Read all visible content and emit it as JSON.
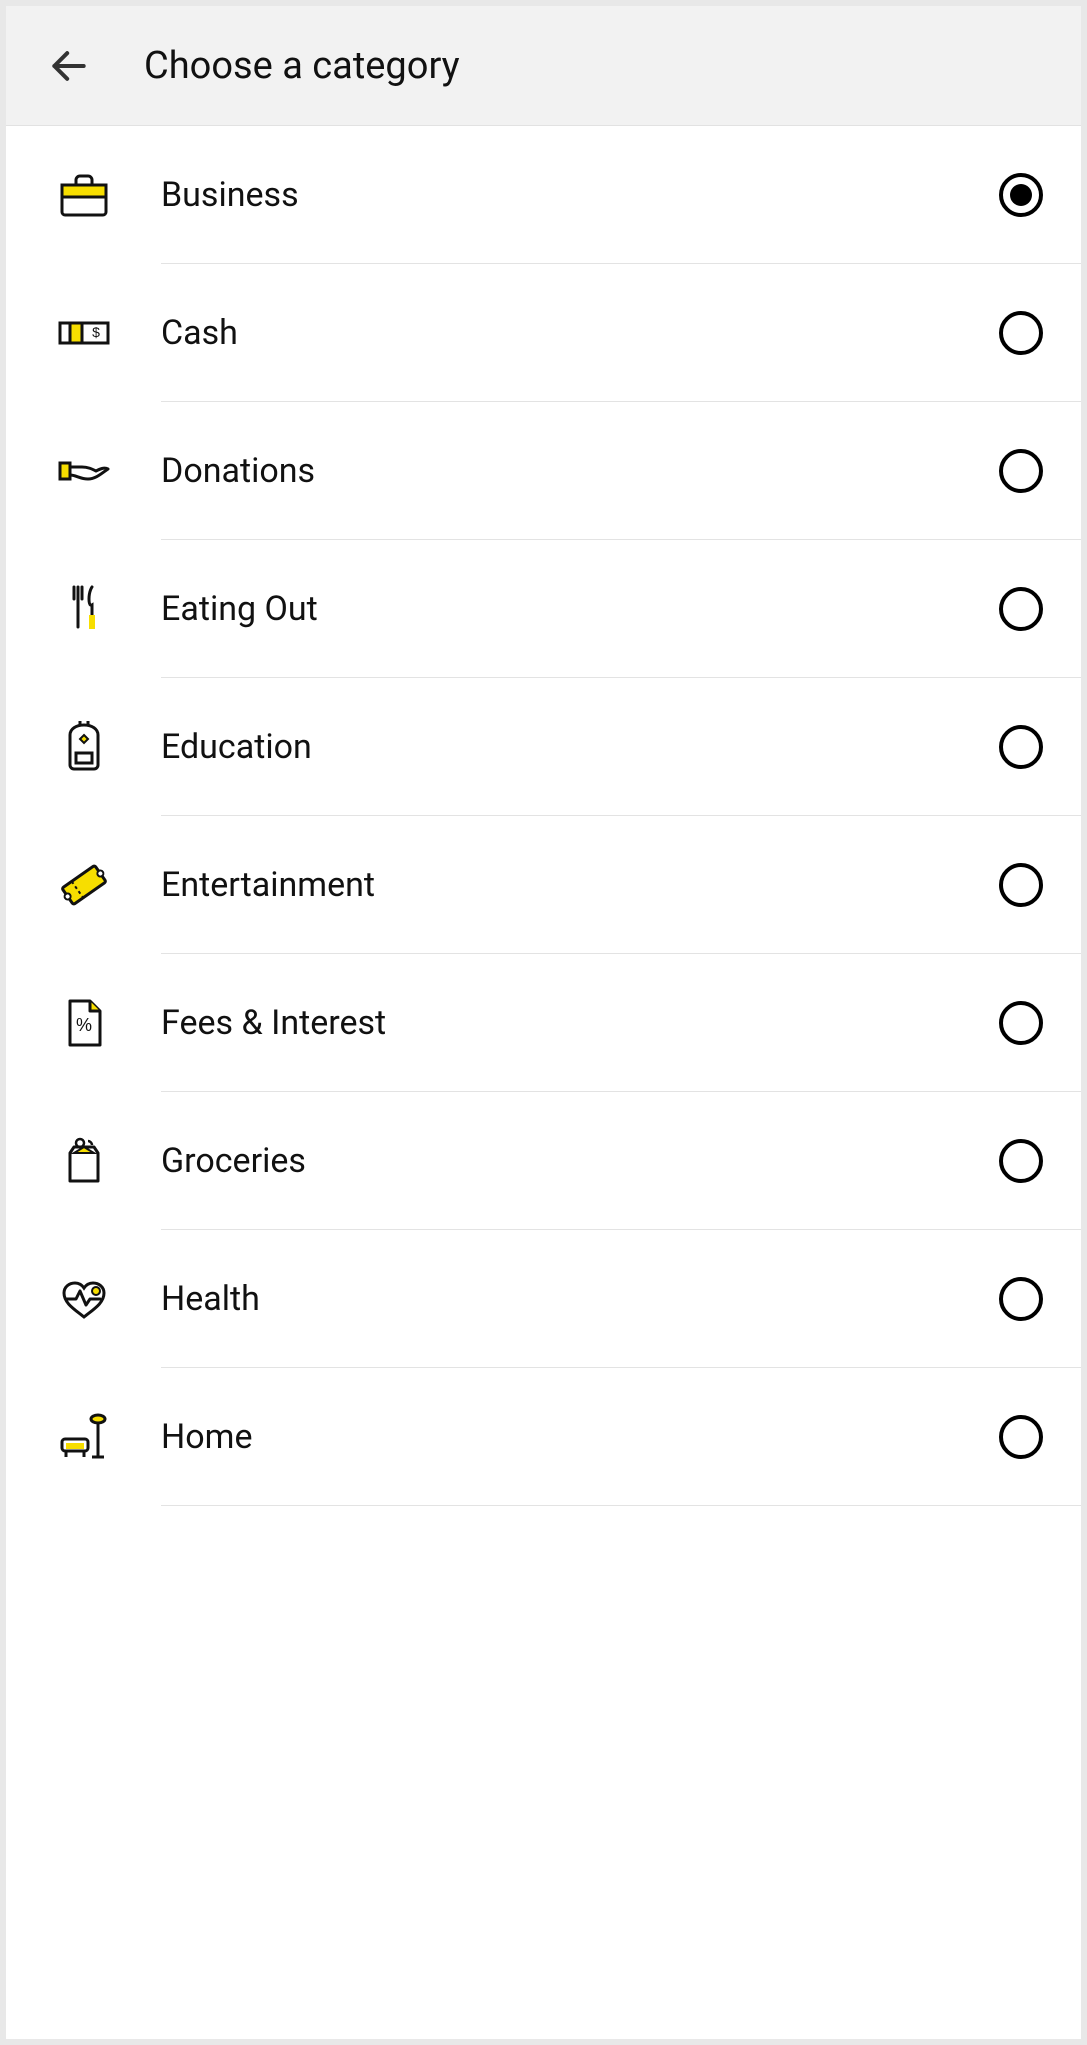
{
  "header": {
    "title": "Choose a category"
  },
  "categories": [
    {
      "id": "business",
      "label": "Business",
      "icon": "briefcase-icon",
      "selected": true
    },
    {
      "id": "cash",
      "label": "Cash",
      "icon": "cash-icon",
      "selected": false
    },
    {
      "id": "donations",
      "label": "Donations",
      "icon": "hand-coin-icon",
      "selected": false
    },
    {
      "id": "eating-out",
      "label": "Eating Out",
      "icon": "fork-knife-icon",
      "selected": false
    },
    {
      "id": "education",
      "label": "Education",
      "icon": "backpack-icon",
      "selected": false
    },
    {
      "id": "entertainment",
      "label": "Entertainment",
      "icon": "ticket-icon",
      "selected": false
    },
    {
      "id": "fees",
      "label": "Fees & Interest",
      "icon": "percent-doc-icon",
      "selected": false
    },
    {
      "id": "groceries",
      "label": "Groceries",
      "icon": "grocery-bag-icon",
      "selected": false
    },
    {
      "id": "health",
      "label": "Health",
      "icon": "heartbeat-icon",
      "selected": false
    },
    {
      "id": "home",
      "label": "Home",
      "icon": "furniture-icon",
      "selected": false
    }
  ],
  "colors": {
    "accent": "#f7de00",
    "stroke": "#111111"
  }
}
